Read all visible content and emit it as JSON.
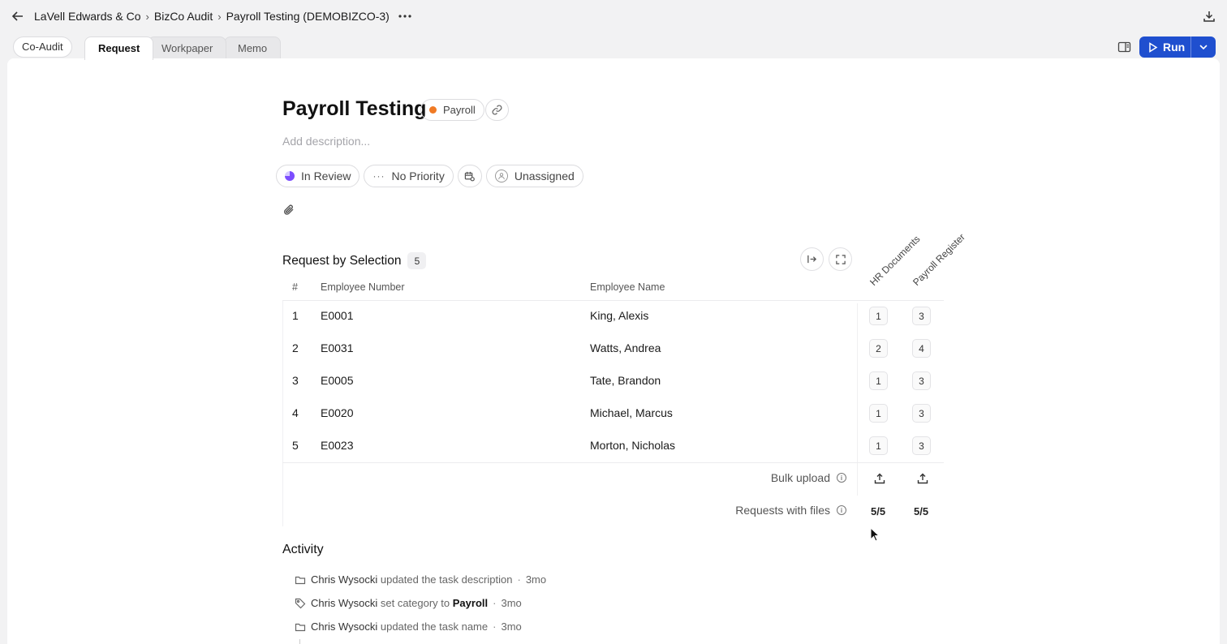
{
  "breadcrumb": [
    "LaVell Edwards & Co",
    "BizCo Audit",
    "Payroll Testing (DEMOBIZCO-3)"
  ],
  "tabs": {
    "coaudit": "Co-Audit",
    "items": [
      "Request",
      "Workpaper",
      "Memo"
    ],
    "active": "Request"
  },
  "run_label": "Run",
  "task": {
    "title": "Payroll Testing",
    "category": "Payroll",
    "category_color": "#f07a24",
    "description_placeholder": "Add description...",
    "status": "In Review",
    "priority": "No Priority",
    "assignee": "Unassigned"
  },
  "selection": {
    "title": "Request by Selection",
    "count": "5",
    "columns": {
      "index": "#",
      "number": "Employee Number",
      "name": "Employee Name",
      "hr": "HR Documents",
      "payroll": "Payroll Register"
    },
    "rows": [
      {
        "idx": "1",
        "number": "E0001",
        "name": "King, Alexis",
        "hr": "1",
        "payroll": "3"
      },
      {
        "idx": "2",
        "number": "E0031",
        "name": "Watts, Andrea",
        "hr": "2",
        "payroll": "4"
      },
      {
        "idx": "3",
        "number": "E0005",
        "name": "Tate, Brandon",
        "hr": "1",
        "payroll": "3"
      },
      {
        "idx": "4",
        "number": "E0020",
        "name": "Michael, Marcus",
        "hr": "1",
        "payroll": "3"
      },
      {
        "idx": "5",
        "number": "E0023",
        "name": "Morton, Nicholas",
        "hr": "1",
        "payroll": "3"
      }
    ],
    "bulk_upload": "Bulk upload",
    "requests_with_files": "Requests with files",
    "hr_ratio": "5/5",
    "payroll_ratio": "5/5"
  },
  "activity": {
    "title": "Activity",
    "items": [
      {
        "who": "Chris Wysocki",
        "action": "updated the task description",
        "extra": "",
        "time": "3mo",
        "icon": "folder-icon"
      },
      {
        "who": "Chris Wysocki",
        "action": "set category to",
        "extra": "Payroll",
        "time": "3mo",
        "icon": "tag-icon"
      },
      {
        "who": "Chris Wysocki",
        "action": "updated the task name",
        "extra": "",
        "time": "3mo",
        "icon": "folder-icon"
      }
    ]
  }
}
